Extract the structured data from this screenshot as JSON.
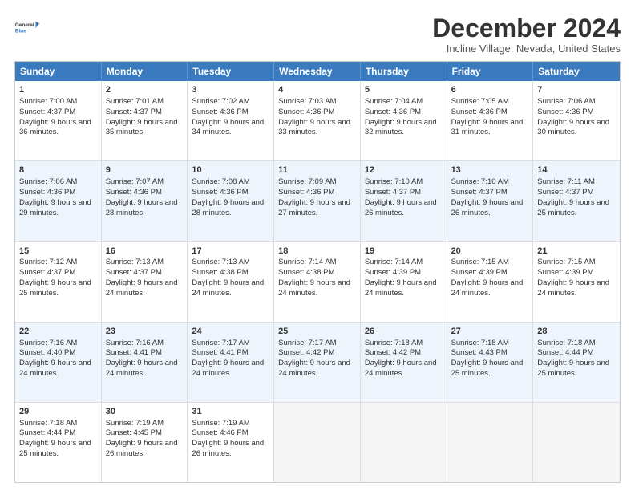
{
  "logo": {
    "line1": "General",
    "line2": "Blue"
  },
  "title": "December 2024",
  "subtitle": "Incline Village, Nevada, United States",
  "header_days": [
    "Sunday",
    "Monday",
    "Tuesday",
    "Wednesday",
    "Thursday",
    "Friday",
    "Saturday"
  ],
  "weeks": [
    [
      {
        "day": "1",
        "sunrise": "Sunrise: 7:00 AM",
        "sunset": "Sunset: 4:37 PM",
        "daylight": "Daylight: 9 hours and 36 minutes."
      },
      {
        "day": "2",
        "sunrise": "Sunrise: 7:01 AM",
        "sunset": "Sunset: 4:37 PM",
        "daylight": "Daylight: 9 hours and 35 minutes."
      },
      {
        "day": "3",
        "sunrise": "Sunrise: 7:02 AM",
        "sunset": "Sunset: 4:36 PM",
        "daylight": "Daylight: 9 hours and 34 minutes."
      },
      {
        "day": "4",
        "sunrise": "Sunrise: 7:03 AM",
        "sunset": "Sunset: 4:36 PM",
        "daylight": "Daylight: 9 hours and 33 minutes."
      },
      {
        "day": "5",
        "sunrise": "Sunrise: 7:04 AM",
        "sunset": "Sunset: 4:36 PM",
        "daylight": "Daylight: 9 hours and 32 minutes."
      },
      {
        "day": "6",
        "sunrise": "Sunrise: 7:05 AM",
        "sunset": "Sunset: 4:36 PM",
        "daylight": "Daylight: 9 hours and 31 minutes."
      },
      {
        "day": "7",
        "sunrise": "Sunrise: 7:06 AM",
        "sunset": "Sunset: 4:36 PM",
        "daylight": "Daylight: 9 hours and 30 minutes."
      }
    ],
    [
      {
        "day": "8",
        "sunrise": "Sunrise: 7:06 AM",
        "sunset": "Sunset: 4:36 PM",
        "daylight": "Daylight: 9 hours and 29 minutes."
      },
      {
        "day": "9",
        "sunrise": "Sunrise: 7:07 AM",
        "sunset": "Sunset: 4:36 PM",
        "daylight": "Daylight: 9 hours and 28 minutes."
      },
      {
        "day": "10",
        "sunrise": "Sunrise: 7:08 AM",
        "sunset": "Sunset: 4:36 PM",
        "daylight": "Daylight: 9 hours and 28 minutes."
      },
      {
        "day": "11",
        "sunrise": "Sunrise: 7:09 AM",
        "sunset": "Sunset: 4:36 PM",
        "daylight": "Daylight: 9 hours and 27 minutes."
      },
      {
        "day": "12",
        "sunrise": "Sunrise: 7:10 AM",
        "sunset": "Sunset: 4:37 PM",
        "daylight": "Daylight: 9 hours and 26 minutes."
      },
      {
        "day": "13",
        "sunrise": "Sunrise: 7:10 AM",
        "sunset": "Sunset: 4:37 PM",
        "daylight": "Daylight: 9 hours and 26 minutes."
      },
      {
        "day": "14",
        "sunrise": "Sunrise: 7:11 AM",
        "sunset": "Sunset: 4:37 PM",
        "daylight": "Daylight: 9 hours and 25 minutes."
      }
    ],
    [
      {
        "day": "15",
        "sunrise": "Sunrise: 7:12 AM",
        "sunset": "Sunset: 4:37 PM",
        "daylight": "Daylight: 9 hours and 25 minutes."
      },
      {
        "day": "16",
        "sunrise": "Sunrise: 7:13 AM",
        "sunset": "Sunset: 4:37 PM",
        "daylight": "Daylight: 9 hours and 24 minutes."
      },
      {
        "day": "17",
        "sunrise": "Sunrise: 7:13 AM",
        "sunset": "Sunset: 4:38 PM",
        "daylight": "Daylight: 9 hours and 24 minutes."
      },
      {
        "day": "18",
        "sunrise": "Sunrise: 7:14 AM",
        "sunset": "Sunset: 4:38 PM",
        "daylight": "Daylight: 9 hours and 24 minutes."
      },
      {
        "day": "19",
        "sunrise": "Sunrise: 7:14 AM",
        "sunset": "Sunset: 4:39 PM",
        "daylight": "Daylight: 9 hours and 24 minutes."
      },
      {
        "day": "20",
        "sunrise": "Sunrise: 7:15 AM",
        "sunset": "Sunset: 4:39 PM",
        "daylight": "Daylight: 9 hours and 24 minutes."
      },
      {
        "day": "21",
        "sunrise": "Sunrise: 7:15 AM",
        "sunset": "Sunset: 4:39 PM",
        "daylight": "Daylight: 9 hours and 24 minutes."
      }
    ],
    [
      {
        "day": "22",
        "sunrise": "Sunrise: 7:16 AM",
        "sunset": "Sunset: 4:40 PM",
        "daylight": "Daylight: 9 hours and 24 minutes."
      },
      {
        "day": "23",
        "sunrise": "Sunrise: 7:16 AM",
        "sunset": "Sunset: 4:41 PM",
        "daylight": "Daylight: 9 hours and 24 minutes."
      },
      {
        "day": "24",
        "sunrise": "Sunrise: 7:17 AM",
        "sunset": "Sunset: 4:41 PM",
        "daylight": "Daylight: 9 hours and 24 minutes."
      },
      {
        "day": "25",
        "sunrise": "Sunrise: 7:17 AM",
        "sunset": "Sunset: 4:42 PM",
        "daylight": "Daylight: 9 hours and 24 minutes."
      },
      {
        "day": "26",
        "sunrise": "Sunrise: 7:18 AM",
        "sunset": "Sunset: 4:42 PM",
        "daylight": "Daylight: 9 hours and 24 minutes."
      },
      {
        "day": "27",
        "sunrise": "Sunrise: 7:18 AM",
        "sunset": "Sunset: 4:43 PM",
        "daylight": "Daylight: 9 hours and 25 minutes."
      },
      {
        "day": "28",
        "sunrise": "Sunrise: 7:18 AM",
        "sunset": "Sunset: 4:44 PM",
        "daylight": "Daylight: 9 hours and 25 minutes."
      }
    ],
    [
      {
        "day": "29",
        "sunrise": "Sunrise: 7:18 AM",
        "sunset": "Sunset: 4:44 PM",
        "daylight": "Daylight: 9 hours and 25 minutes."
      },
      {
        "day": "30",
        "sunrise": "Sunrise: 7:19 AM",
        "sunset": "Sunset: 4:45 PM",
        "daylight": "Daylight: 9 hours and 26 minutes."
      },
      {
        "day": "31",
        "sunrise": "Sunrise: 7:19 AM",
        "sunset": "Sunset: 4:46 PM",
        "daylight": "Daylight: 9 hours and 26 minutes."
      },
      null,
      null,
      null,
      null
    ]
  ]
}
